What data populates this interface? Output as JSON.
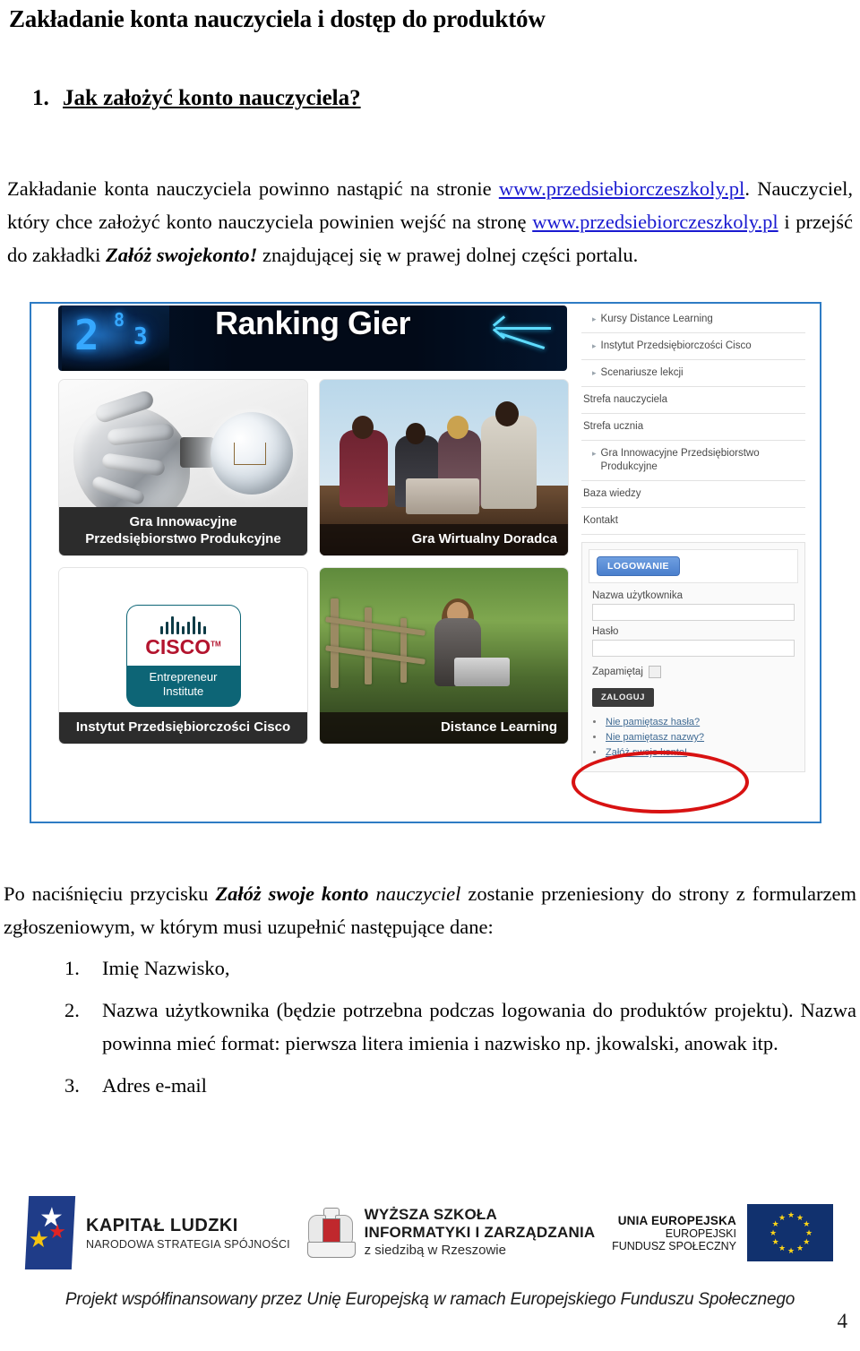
{
  "document": {
    "title": "Zakładanie konta nauczyciela i dostęp do produktów",
    "section_number": "1.",
    "section_title": "Jak założyć konto nauczyciela?",
    "intro": {
      "part1": "Zakładanie konta nauczyciela powinno nastąpić na stronie ",
      "link1": "www.przedsiebiorczeszkoly.pl",
      "part2": ". Nauczyciel, który chce założyć konto nauczyciela powinien wejść na stronę ",
      "link2": "www.przedsiebiorczeszkoly.pl",
      "part3": " i przejść do zakładki ",
      "bold1": "Załóż swojekonto!",
      "part4": " znajdującej się w prawej dolnej części portalu."
    },
    "after_image": {
      "part1": "Po naciśnięciu przycisku ",
      "bold1": "Załóż swoje konto",
      "italic1": " nauczyciel",
      "part2": " zostanie przeniesiony do strony z formularzem zgłoszeniowym, w którym musi uzupełnić następujące dane:"
    },
    "list": [
      {
        "marker": "1.",
        "text": "Imię Nazwisko,"
      },
      {
        "marker": "2.",
        "text": "Nazwa użytkownika (będzie potrzebna podczas logowania do produktów projektu). Nazwa powinna mieć format: pierwsza litera imienia i nazwisko np. jkowalski, anowak itp."
      },
      {
        "marker": "3.",
        "text": "Adres e-mail"
      }
    ],
    "page_number": "4"
  },
  "screenshot": {
    "banner": {
      "title": "Ranking Gier",
      "digit_left": "2",
      "digit_mid": "8",
      "digit_small": "3"
    },
    "tiles": [
      {
        "caption": "Gra Innowacyjne\nPrzedsiębiorstwo Produkcyjne",
        "caption_line1": "Gra Innowacyjne",
        "caption_line2": "Przedsiębiorstwo Produkcyjne"
      },
      {
        "caption": "Instytut Przedsiębiorczości Cisco"
      },
      {
        "caption": "Gra Wirtualny Doradca"
      },
      {
        "caption": "Distance Learning"
      }
    ],
    "cisco_logo": {
      "word": "CISCO",
      "tm": "TM",
      "line1": "Entrepreneur",
      "line2": "Institute"
    },
    "nav_items": [
      {
        "label": "Kursy Distance Learning",
        "arrow": true
      },
      {
        "label": "Instytut Przedsiębiorczości Cisco",
        "arrow": true
      },
      {
        "label": "Scenariusze lekcji",
        "arrow": true
      },
      {
        "label": "Strefa nauczyciela",
        "arrow": false
      },
      {
        "label": "Strefa ucznia",
        "arrow": false
      },
      {
        "label": "Gra Innowacyjne Przedsiębiorstwo Produkcyjne",
        "arrow": true
      },
      {
        "label": "Baza wiedzy",
        "arrow": false
      },
      {
        "label": "Kontakt",
        "arrow": false
      }
    ],
    "login": {
      "tab_label": "LOGOWANIE",
      "username_label": "Nazwa użytkownika",
      "username_value": "",
      "password_label": "Hasło",
      "password_value": "",
      "remember_label": "Zapamiętaj",
      "submit_label": "ZALOGUJ",
      "links": [
        "Nie pamiętasz hasła?",
        "Nie pamiętasz nazwy?",
        "Załóż swoje konto!"
      ]
    },
    "annotation_color": "#d81212"
  },
  "footer": {
    "kapital_ludzki": {
      "line1": "KAPITAŁ LUDZKI",
      "line2": "NARODOWA STRATEGIA SPÓJNOŚCI"
    },
    "wsiz": {
      "line1": "WYŻSZA SZKOŁA",
      "line2": "INFORMATYKI I ZARZĄDZANIA",
      "line3": "z siedzibą w Rzeszowie"
    },
    "unia": {
      "line1": "UNIA EUROPEJSKA",
      "line2": "EUROPEJSKI",
      "line3": "FUNDUSZ SPOŁECZNY"
    },
    "caption": "Projekt współfinansowany przez Unię Europejską w ramach Europejskiego Funduszu Społecznego"
  }
}
